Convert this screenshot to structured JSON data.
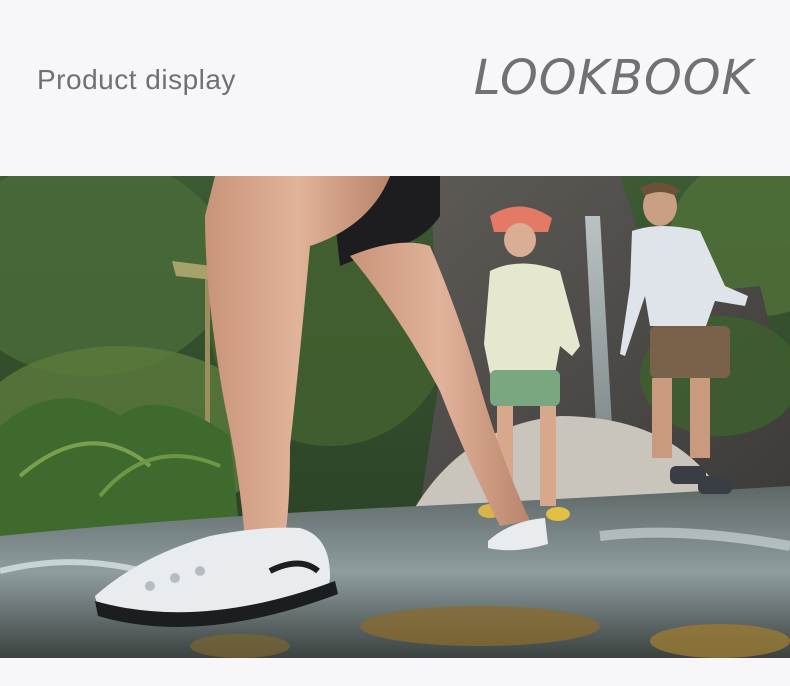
{
  "header": {
    "subtitle": "Product display",
    "title": "LOOKBOOK"
  },
  "photo": {
    "subject": "lookbook-photo",
    "colors": {
      "foliage_dark": "#2f4a2a",
      "foliage_light": "#5d7d3f",
      "rock": "#6d6a66",
      "water": "#a9b6b8",
      "skin": "#d8a88f",
      "shoe": "#e9ecef"
    }
  }
}
